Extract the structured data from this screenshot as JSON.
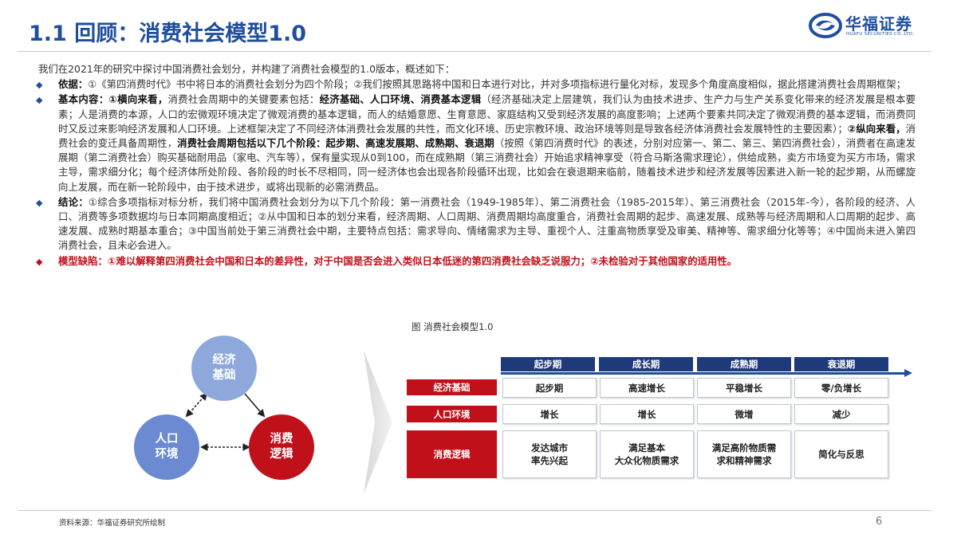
{
  "header": {
    "title": "1.1 回顾：消费社会模型1.0",
    "logo_cn": "华福证券",
    "logo_en": "HUAFU SECURITIES CO.,LTD."
  },
  "intro": "我们在2021年的研究中探讨中国消费社会划分，并构建了消费社会模型的1.0版本，概述如下：",
  "bullets": {
    "basis": {
      "label": "依据：",
      "text": "①《第四消费时代》书中将日本的消费社会划分为四个阶段；②我们按照其思路将中国和日本进行对比，并对多项指标进行量化对标，发现多个角度高度相似，据此搭建消费社会周期框架；"
    },
    "content": {
      "label": "基本内容：",
      "p1": "①横向来看，",
      "p2": "消费社会周期中的关键要素包括：",
      "p3": "经济基础、人口环境、消费基本逻辑",
      "p4": "（经济基础决定上层建筑，我们认为由技术进步、生产力与生产关系变化带来的经济发展是根本要素；人是消费的本源，人口的宏微观环境决定了微观消费的基本逻辑，而人的结婚意愿、生育意愿、家庭结构又受到经济发展的高度影响；上述两个要素共同决定了微观消费的基本逻辑，而消费同时又反过来影响经济发展和人口环境。上述框架决定了不同经济体消费社会发展的共性，而文化环境、历史宗教环境、政治环境等则是导致各经济体消费社会发展特性的主要因素）；",
      "p5": "②纵向来看，",
      "p6": "消费社会的变迁具备周期性，",
      "p7": "消费社会周期包括以下几个阶段：起步期、高速发展期、成熟期、衰退期",
      "p8": "（按照《第四消费时代》的表述，分别对应第一、第二、第三、第四消费社会），消费者在高速发展期（第二消费社会）购买基础耐用品（家电、汽车等），保有量实现从0到100，而在成熟期（第三消费社会）开始追求精神享受（符合马斯洛需求理论），供给成熟，卖方市场变为买方市场，需求主导，需求细分化；每个经济体所处阶段、各阶段的时长不尽相同，同一经济体也会出现各阶段循环出现，比如会在衰退期来临前，随着技术进步和经济发展等因素进入新一轮的起步期，从而螺旋向上发展，而在新一轮阶段中，由于技术进步，或将出现新的必需消费品。"
    },
    "conclusion": {
      "label": "结论：",
      "text": "①综合多项指标对标分析，我们将中国消费社会划分为以下几个阶段：第一消费社会（1949-1985年）、第二消费社会（1985-2015年）、第三消费社会（2015年-今），各阶段的经济、人口、消费等多项数据均与日本同期高度相近；②从中国和日本的划分来看，经济周期、人口周期、消费周期均高度重合，消费社会周期的起步、高速发展、成熟等与经济周期和人口周期的起步、高速发展、成熟时期基本重合；③中国当前处于第三消费社会中期，主要特点包括：需求导向、情绪需求为主导、重视个人、注重高物质享受及审美、精神等、需求细分化等等；④中国尚未进入第四消费社会，且未必会进入。"
    },
    "flaw": {
      "label": "模型缺陷：",
      "text": "①难以解释第四消费社会中国和日本的差异性，对于中国是否会进入类似日本低迷的第四消费社会缺乏说服力；②未检验对于其他国家的适用性。"
    }
  },
  "cycle": {
    "econ": [
      "经济",
      "基础"
    ],
    "pop": [
      "人口",
      "环境"
    ],
    "cons": [
      "消费",
      "逻辑"
    ]
  },
  "figure": {
    "caption": "图 消费社会模型1.0",
    "phases": [
      "起步期",
      "成长期",
      "成熟期",
      "衰退期"
    ],
    "rows": [
      {
        "label": "经济基础",
        "cells": [
          "起步期",
          "高速增长",
          "平稳增长",
          "零/负增长"
        ]
      },
      {
        "label": "人口环境",
        "cells": [
          "增长",
          "增长",
          "微增",
          "减少"
        ]
      },
      {
        "label": "消费逻辑",
        "cells": [
          "发达城市\n率先兴起",
          "满足基本\n大众化物质需求",
          "满足高阶物质需\n求和精神需求",
          "简化与反思"
        ]
      }
    ]
  },
  "colors": {
    "brand_blue": "#1f4e9c",
    "accent_red": "#c0101a",
    "phase_header": "#1f3a7a"
  },
  "footer": {
    "source": "资料来源：华福证券研究所绘制",
    "page": "6"
  }
}
